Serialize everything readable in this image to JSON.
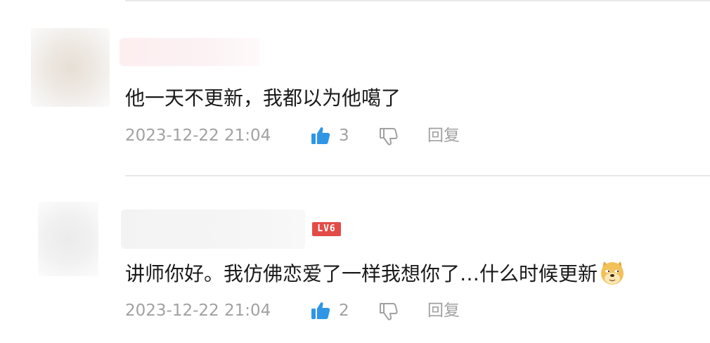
{
  "comments": [
    {
      "text": "他一天不更新，我都以为他噶了",
      "timestamp": "2023-12-22 21:04",
      "likes": "3",
      "reply_label": "回复",
      "level_badge": null
    },
    {
      "text": "讲师你好。我仿佛恋爱了一样我想你了…什么时候更新",
      "timestamp": "2023-12-22 21:04",
      "likes": "2",
      "reply_label": "回复",
      "level_badge": "LV6",
      "emoji": "doge-icon"
    }
  ],
  "colors": {
    "text_primary": "#1a1a1a",
    "text_meta": "#a1a1a1",
    "like_active": "#2f96e6",
    "level_badge": "#e34b47",
    "divider": "#e8e8e8"
  }
}
